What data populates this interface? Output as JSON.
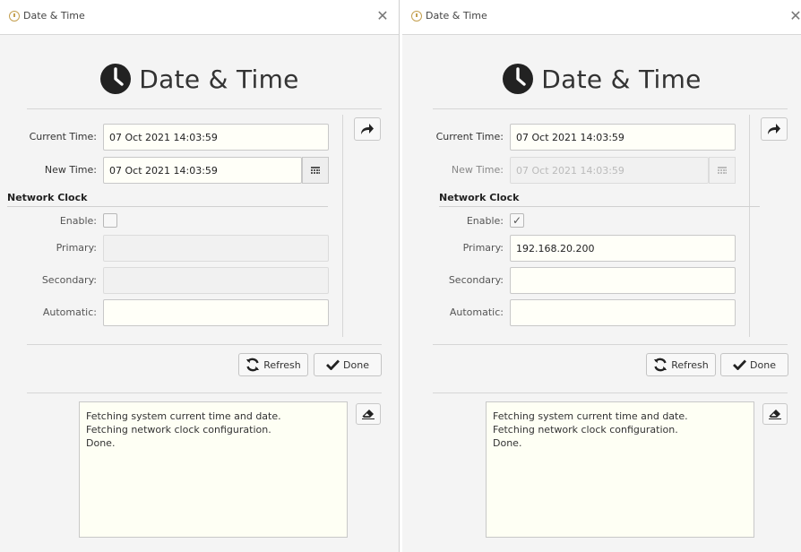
{
  "windows": [
    {
      "title": "Date & Time",
      "header": "Date & Time",
      "current_time_label": "Current Time:",
      "current_time_value": "07 Oct 2021 14:03:59",
      "new_time_label": "New Time:",
      "new_time_value": "07 Oct 2021 14:03:59",
      "new_time_disabled": false,
      "network_clock_title": "Network Clock",
      "enable_label": "Enable:",
      "enable_checked": false,
      "primary_label": "Primary:",
      "primary_value": "",
      "secondary_label": "Secondary:",
      "secondary_value": "",
      "automatic_label": "Automatic:",
      "automatic_value": "",
      "refresh_label": "Refresh",
      "done_label": "Done",
      "log_lines": [
        "Fetching system current time and date.",
        "Fetching network clock configuration.",
        "Done."
      ]
    },
    {
      "title": "Date & Time",
      "header": "Date & Time",
      "current_time_label": "Current Time:",
      "current_time_value": "07 Oct 2021 14:03:59",
      "new_time_label": "New Time:",
      "new_time_value": "07 Oct 2021 14:03:59",
      "new_time_disabled": true,
      "network_clock_title": "Network Clock",
      "enable_label": "Enable:",
      "enable_checked": true,
      "primary_label": "Primary:",
      "primary_value": "192.168.20.200",
      "secondary_label": "Secondary:",
      "secondary_value": "",
      "automatic_label": "Automatic:",
      "automatic_value": "",
      "refresh_label": "Refresh",
      "done_label": "Done",
      "log_lines": [
        "Fetching system current time and date.",
        "Fetching network clock configuration.",
        "Done."
      ]
    }
  ],
  "icons": {
    "app": "clock-icon",
    "close": "close-icon",
    "apply": "share-arrow-icon",
    "calendar": "calendar-icon",
    "refresh": "refresh-icon",
    "done": "checkmark-icon",
    "clear_log": "eraser-icon"
  },
  "colors": {
    "field_bg": "#fffff8",
    "log_bg": "#fefff4",
    "window_bg": "#f4f4f4",
    "disabled_bg": "#f1f1f1"
  }
}
